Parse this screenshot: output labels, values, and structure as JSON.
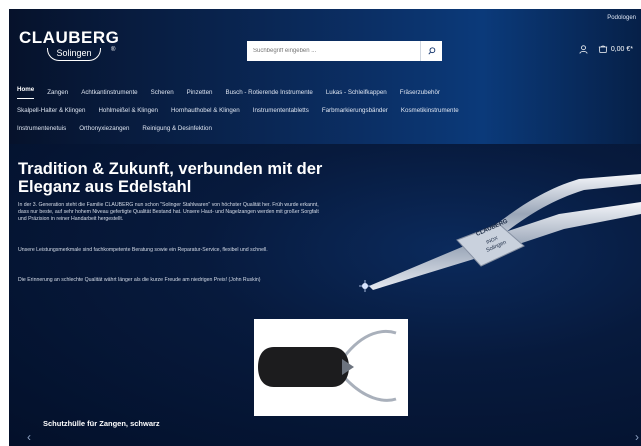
{
  "header": {
    "logo_top": "CLAUBERG",
    "logo_reg": "®",
    "logo_bottom": "Solingen",
    "top_right_link": "Podologen",
    "search_placeholder": "Suchbegriff eingeben ...",
    "cart_amount": "0,00 €*",
    "icons": {
      "search": "search-icon",
      "account": "user-icon",
      "cart": "cart-icon"
    }
  },
  "nav": {
    "items": [
      "Home",
      "Zangen",
      "Achtkantinstrumente",
      "Scheren",
      "Pinzetten",
      "Busch - Rotierende Instrumente",
      "Lukas - Schleifkappen",
      "Fräserzubehör",
      "Skalpell-Halter & Klingen",
      "Hohlmeißel & Klingen",
      "Hornhauthobel & Klingen",
      "Instrumententabletts",
      "Farbmarkierungsbänder",
      "Kosmetikinstrumente",
      "Instrumentenetuis",
      "Orthonyxiezangen",
      "Reinigung & Desinfektion"
    ]
  },
  "hero": {
    "title": "Tradition & Zukunft, verbunden mit der Eleganz aus Edelstahl",
    "paragraphs": [
      "In der 3. Generation steht die Familie CLAUBERG nun schon \"Solinger Stahlwaren\" von höchster Qualität her. Früh wurde erkannt, dass nur beste, auf sehr hohem Niveau gefertigte Qualität Bestand hat. Unsere Haut- und Nagelzangen werden mit großer Sorgfalt und Präzision in reiner Handarbeit hergestellt.",
      "Unsere Leistungsmerkmale sind fachkompetente Beratung sowie ein Reparatur-Service, flexibel und schnell.",
      "Die Erinnerung an schlechte Qualität währt länger als die kurze Freude am niedrigen Preis! (John Ruskin)"
    ],
    "product_caption": "Schutzhülle für Zangen, schwarz",
    "tool_engraving": [
      "CLAUBERG",
      "INOX",
      "Solingen"
    ]
  },
  "colors": {
    "header_bg": "#0b2e63",
    "hero_bg": "#071a3d",
    "accent": "#ffffff"
  }
}
